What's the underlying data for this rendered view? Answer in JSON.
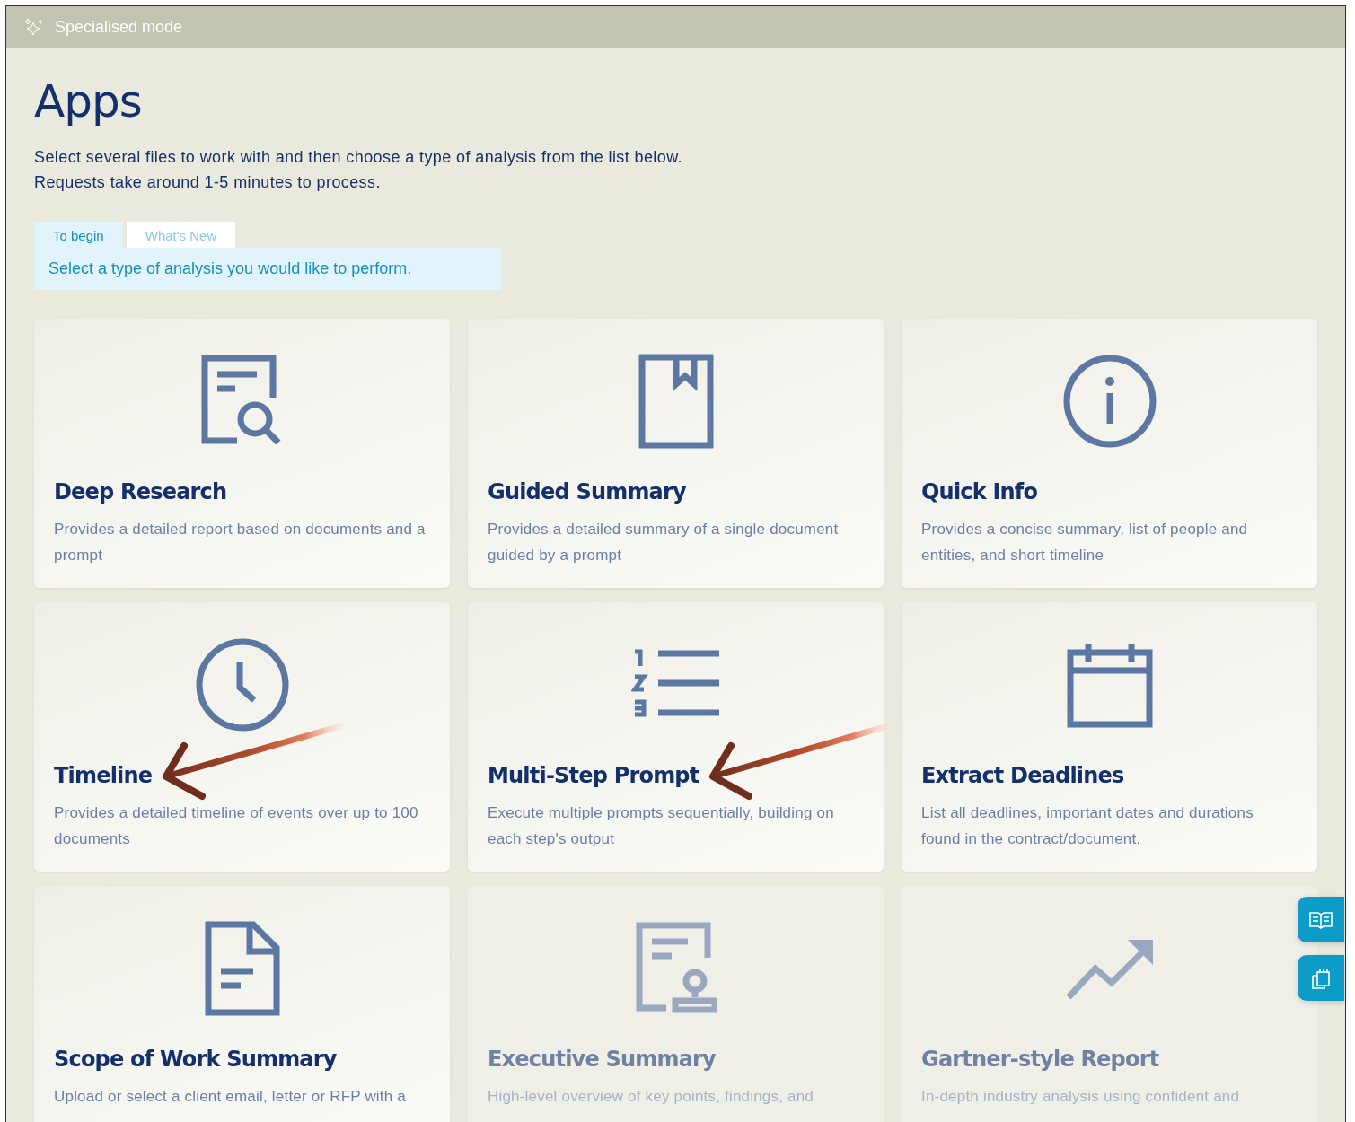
{
  "top_bar": {
    "title": "Specialised mode"
  },
  "heading": "Apps",
  "intro": [
    "Select several files to work with and then choose a type of analysis from the list below.",
    "Requests take around 1-5 minutes to process."
  ],
  "tabs": [
    {
      "label": "To begin",
      "selected": true
    },
    {
      "label": "What's New",
      "selected": false
    }
  ],
  "tab_panel": {
    "text": "Select a type of analysis you would like to perform."
  },
  "apps": [
    {
      "kind": "document-search",
      "title": "Deep Research",
      "description": "Provides a detailed report based on documents and a prompt",
      "disabled": false,
      "annotated": false
    },
    {
      "kind": "bookmark",
      "title": "Guided Summary",
      "description": "Provides a detailed summary of a single document guided by a prompt",
      "disabled": false,
      "annotated": false
    },
    {
      "kind": "info",
      "title": "Quick Info",
      "description": "Provides a concise summary, list of people and entities, and short timeline",
      "disabled": false,
      "annotated": false
    },
    {
      "kind": "clock",
      "title": "Timeline",
      "description": "Provides a detailed timeline of events over up to 100 documents",
      "disabled": false,
      "annotated": true
    },
    {
      "kind": "numbered-list",
      "title": "Multi-Step Prompt",
      "description": "Execute multiple prompts sequentially, building on each step's output",
      "disabled": false,
      "annotated": true
    },
    {
      "kind": "calendar",
      "title": "Extract Deadlines",
      "description": "List all deadlines, important dates and durations found in the contract/document.",
      "disabled": false,
      "annotated": false
    },
    {
      "kind": "document",
      "title": "Scope of Work Summary",
      "description": "Upload or select a client email, letter or RFP with a",
      "disabled": false,
      "annotated": false
    },
    {
      "kind": "certificate",
      "title": "Executive Summary",
      "description": "High-level overview of key points, findings, and",
      "disabled": true,
      "annotated": false
    },
    {
      "kind": "trend",
      "title": "Gartner-style Report",
      "description": "In-depth industry analysis using confident and",
      "disabled": true,
      "annotated": false
    }
  ],
  "side_buttons": [
    {
      "kind": "book"
    },
    {
      "kind": "clipboard"
    }
  ]
}
